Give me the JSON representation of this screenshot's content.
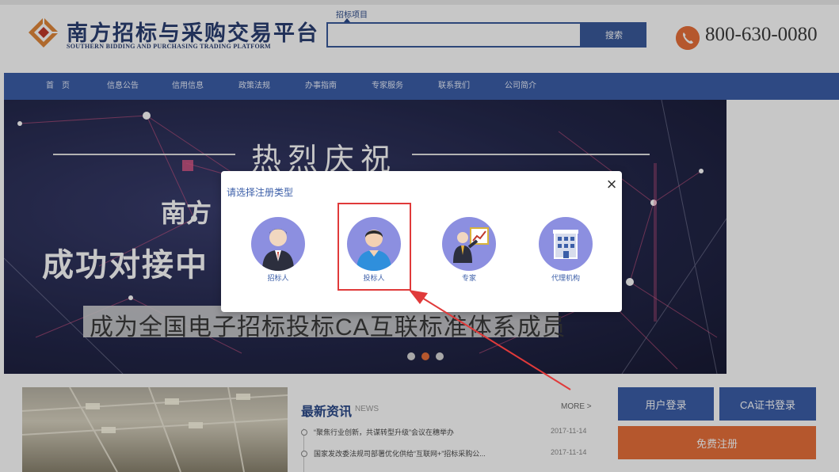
{
  "site": {
    "name_cn": "南方招标与采购交易平台",
    "name_en": "SOUTHERN BIDDING AND PURCHASING TRADING PLATFORM",
    "phone": "800-630-0080"
  },
  "search": {
    "tab_label": "招标项目",
    "button_label": "搜索",
    "value": ""
  },
  "nav": {
    "items": [
      "首　页",
      "信息公告",
      "信用信息",
      "政策法规",
      "办事指南",
      "专家服务",
      "联系我们",
      "公司简介"
    ]
  },
  "banner": {
    "headline": "热烈庆祝",
    "line1": "南方",
    "line2": "成功对接中",
    "strip": "成为全国电子招标投标CA互联标准体系成员",
    "active_slide": 2,
    "slide_count": 3
  },
  "news": {
    "title": "最新资讯",
    "title_en": "NEWS",
    "more_label": "MORE >",
    "items": [
      {
        "text": "“聚焦行业创新，共谋转型升级”会议在穗举办",
        "date": "2017-11-14"
      },
      {
        "text": "国家发改委法规司部署优化供给“互联网+”招标采购公...",
        "date": "2017-11-14"
      }
    ]
  },
  "side_buttons": {
    "login": "用户登录",
    "ca_login": "CA证书登录",
    "register": "免费注册"
  },
  "modal": {
    "title": "请选择注册类型",
    "close_label": "×",
    "options": [
      {
        "label": "招标人",
        "icon": "businessman-icon"
      },
      {
        "label": "投标人",
        "icon": "person-icon"
      },
      {
        "label": "专家",
        "icon": "presenter-chart-icon"
      },
      {
        "label": "代理机构",
        "icon": "building-icon"
      }
    ],
    "highlighted_option": "投标人"
  },
  "colors": {
    "brand_blue": "#3b5ea8",
    "accent_orange": "#e8703a",
    "option_circle": "#8c8fe0",
    "highlight_red": "#e03a3a"
  }
}
